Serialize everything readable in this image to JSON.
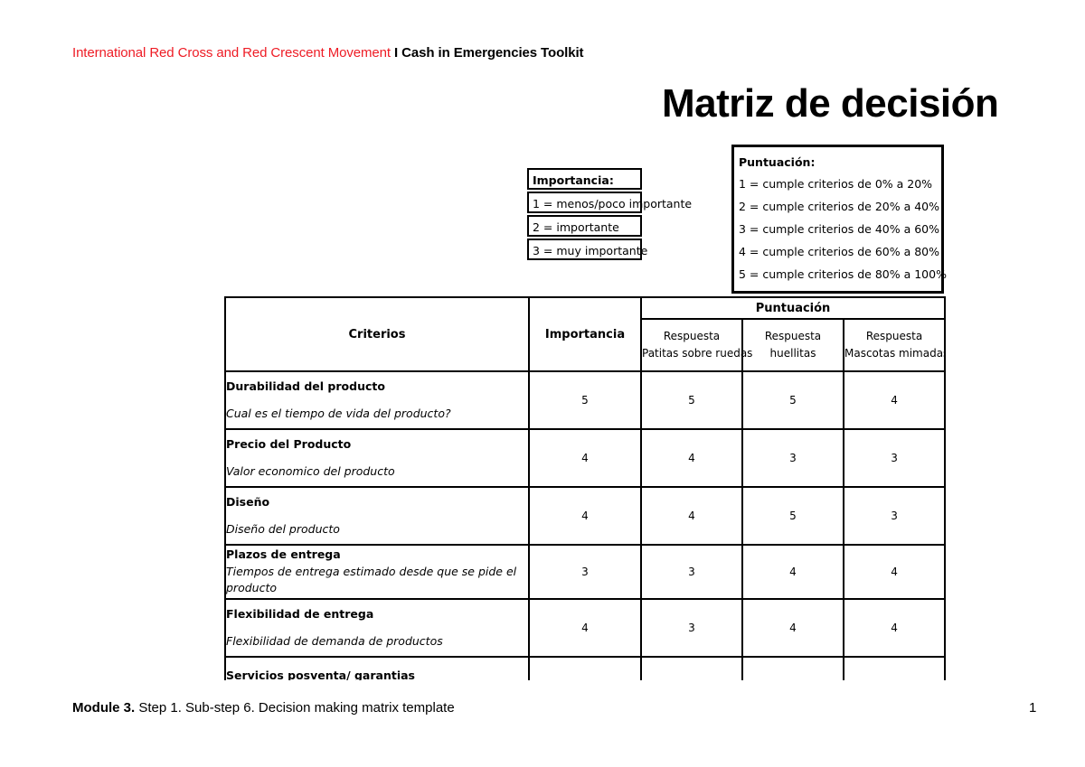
{
  "header": {
    "organization": "International Red Cross and Red Crescent Movement",
    "toolkit": "I Cash in Emergencies Toolkit",
    "org_color": "#ee1c25"
  },
  "title": "Matriz de decisión",
  "legend_importancia": {
    "heading": "Importancia:",
    "items": [
      "1 = menos/poco importante",
      "2 = importante",
      "3 = muy importante"
    ]
  },
  "legend_puntuacion": {
    "heading": "Puntuación:",
    "items": [
      "1 = cumple criterios de 0% a 20%",
      "2 = cumple criterios de 20% a 40%",
      "3 = cumple criterios de 40% a 60%",
      "4 = cumple criterios de 60% a 80%",
      "5 = cumple criterios de 80% a 100%"
    ]
  },
  "matrix": {
    "accent_border_color": "#5b9bd5",
    "headers": {
      "criterios": "Criterios",
      "importancia": "Importancia",
      "puntuacion": "Puntuación",
      "respuesta_label": "Respuesta",
      "respondents": [
        "Patitas sobre ruedas",
        "huellitas",
        "Mascotas mimadas"
      ]
    },
    "rows": [
      {
        "title": "Durabilidad del producto",
        "description": "Cual es el tiempo de vida del producto?",
        "importancia": "5",
        "scores": [
          "5",
          "5",
          "4"
        ]
      },
      {
        "title": "Precio del Producto",
        "description": "Valor economico del producto",
        "importancia": "4",
        "scores": [
          "4",
          "3",
          "3"
        ]
      },
      {
        "title": "Diseño",
        "description": "Diseño del producto",
        "importancia": "4",
        "scores": [
          "4",
          "5",
          "3"
        ]
      },
      {
        "title": "Plazos de entrega",
        "description": "Tiempos de entrega estimado desde que se pide el producto",
        "importancia": "3",
        "scores": [
          "3",
          "4",
          "4"
        ]
      },
      {
        "title": "Flexibilidad de entrega",
        "description": "Flexibilidad de demanda de productos",
        "importancia": "4",
        "scores": [
          "3",
          "4",
          "4"
        ]
      },
      {
        "title": "Servicios posventa/ garantias",
        "description": "",
        "importancia": "",
        "scores": [
          "",
          "",
          ""
        ]
      }
    ]
  },
  "footer": {
    "module": "Module 3.",
    "text": " Step 1. Sub-step 6. Decision making matrix template",
    "page_number": "1"
  }
}
